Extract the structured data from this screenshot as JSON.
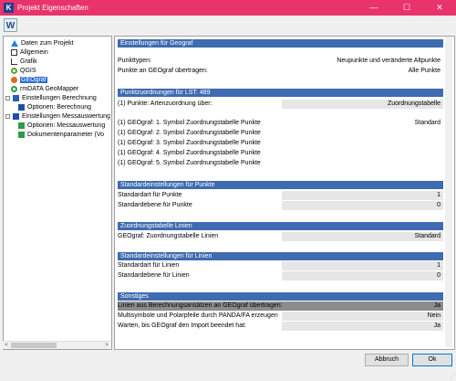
{
  "window": {
    "title": "Projekt Eigenschaften",
    "app_icon_letter": "K",
    "minimize": "—",
    "maximize": "☐",
    "close": "✕",
    "accent": "#e8336b"
  },
  "toolbar": {
    "icon_letter": "W"
  },
  "tree": {
    "items": [
      {
        "label": "Daten zum Projekt",
        "icon": "triangle-icon"
      },
      {
        "label": "Allgemein",
        "icon": "document-icon"
      },
      {
        "label": "Grafik",
        "icon": "graph-icon"
      },
      {
        "label": "QGIS",
        "icon": "qgis-icon"
      },
      {
        "label": "GEOgraf",
        "icon": "geograf-icon"
      },
      {
        "label": "rmDATA GeoMapper",
        "icon": "geomapper-icon"
      },
      {
        "label": "Einstellungen Berechnung",
        "icon": "calc-icon"
      },
      {
        "label": "Optionen: Berechnung",
        "icon": "option-icon"
      },
      {
        "label": "Einstellungen Messauswertung",
        "icon": "measure-icon"
      },
      {
        "label": "Optionen: Messauswertung",
        "icon": "option-green-icon"
      },
      {
        "label": "Dokumentenparameter (Vo",
        "icon": "docparam-icon"
      }
    ],
    "scroll_left": "<",
    "scroll_right": ">"
  },
  "sections": {
    "s1": {
      "title": "Einstellungen für Geograf",
      "rows": [
        {
          "label": "Punkttypen:",
          "value": "Neupunkte und veränderte Altpunkte"
        },
        {
          "label": "Punkte an GEOgraf übertragen:",
          "value": "Alle Punkte"
        }
      ]
    },
    "s2": {
      "title": "Punktzuordnungen für LST: 489",
      "rows": [
        {
          "label": "(1) Punkte: Artenzuordnung über:",
          "value": "Zuordnungstabelle"
        },
        {
          "label": "(1) GEOgraf: 1. Symbol Zuordnungstabelle Punkte",
          "value": "Standard"
        },
        {
          "label": "(1) GEOgraf: 2. Symbol Zuordnungstabelle Punkte",
          "value": ""
        },
        {
          "label": "(1) GEOgraf: 3. Symbol Zuordnungstabelle Punkte",
          "value": ""
        },
        {
          "label": "(1) GEOgraf: 4. Symbol Zuordnungstabelle Punkte",
          "value": ""
        },
        {
          "label": "(1) GEOgraf: 5. Symbol Zuordnungstabelle Punkte",
          "value": ""
        }
      ]
    },
    "s3": {
      "title": "Standardeinstellungen für Punkte",
      "rows": [
        {
          "label": "Standardart für Punkte",
          "value": "1"
        },
        {
          "label": "Standardebene für Punkte",
          "value": "0"
        }
      ]
    },
    "s4": {
      "title": "Zuordnungstabelle Linien",
      "rows": [
        {
          "label": "GEOgraf: Zuordnungstabelle Linien",
          "value": "Standard"
        }
      ]
    },
    "s5": {
      "title": "Standardeinstellungen für Linien",
      "rows": [
        {
          "label": "Standardart für Linien",
          "value": "1"
        },
        {
          "label": "Standardebene für Linien",
          "value": "0"
        }
      ]
    },
    "s6": {
      "title": "Sonstiges",
      "rows": [
        {
          "label": "Linien aus Berechnungsansätzen an GEOgraf übertragen:",
          "value": "Ja"
        },
        {
          "label": "Multisymbole und Polarpfeile durch PANDA/FA erzeugen",
          "value": "Nein"
        },
        {
          "label": "Warten, bis GEOgraf den Import beendet hat:",
          "value": "Ja"
        }
      ]
    }
  },
  "buttons": {
    "cancel": "Abbruch",
    "ok": "Ok"
  }
}
